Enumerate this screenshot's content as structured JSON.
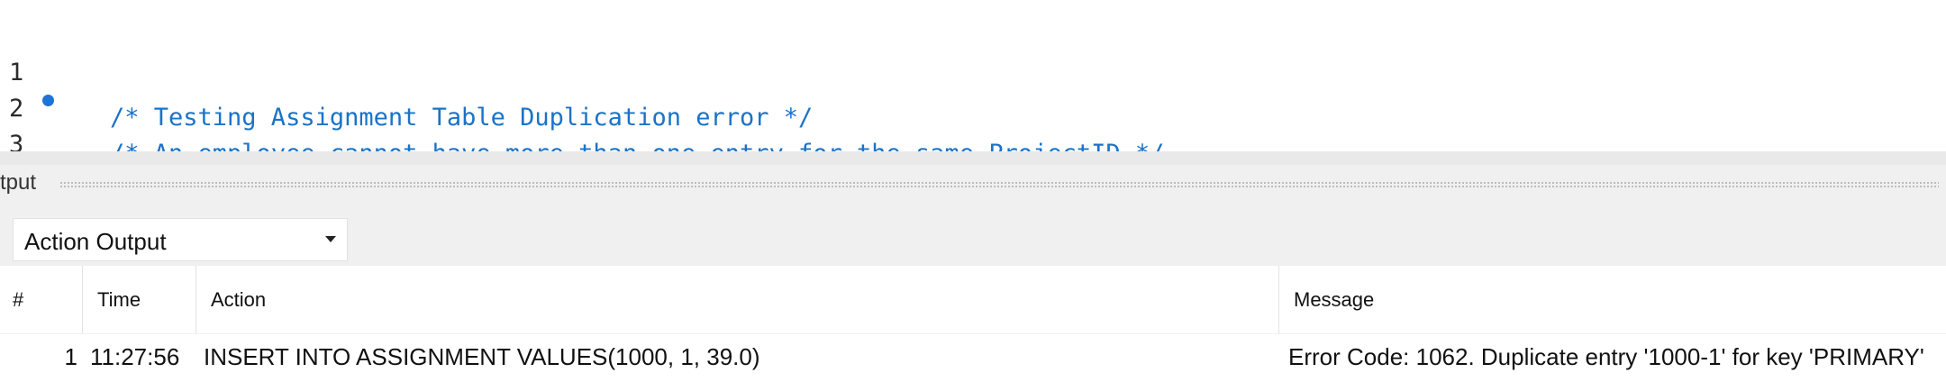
{
  "editor": {
    "lines": [
      {
        "number": "1",
        "tokens": [
          {
            "t": "/* Testing Assignment Table Duplication error */",
            "k": "comment"
          }
        ]
      },
      {
        "number": "2",
        "tokens": [
          {
            "t": "/* An employee cannot have more than one entry for the same ProjectID */",
            "k": "comment"
          }
        ]
      },
      {
        "number": "3",
        "breakpoint": true,
        "tokens": [
          {
            "t": "INSERT INTO",
            "k": "kw"
          },
          {
            "t": " ASSIGNMENT ",
            "k": "id"
          },
          {
            "t": "VALUES",
            "k": "kw"
          },
          {
            "t": "(",
            "k": "punc"
          },
          {
            "t": "1000",
            "k": "num"
          },
          {
            "t": ", ",
            "k": "punc"
          },
          {
            "t": "1",
            "k": "num"
          },
          {
            "t": ", ",
            "k": "punc"
          },
          {
            "t": "39.0",
            "k": "num"
          },
          {
            "t": ");",
            "k": "punc"
          }
        ]
      }
    ]
  },
  "output": {
    "title": "tput",
    "select_value": "Action Output",
    "columns": [
      "#",
      "Time",
      "Action",
      "Message"
    ],
    "rows": [
      {
        "num": "1",
        "time": "11:27:56",
        "action": "INSERT INTO ASSIGNMENT VALUES(1000, 1, 39.0)",
        "message": "Error Code: 1062. Duplicate entry '1000-1' for key 'PRIMARY'"
      }
    ]
  },
  "colors": {
    "keyword": "#1a73c7",
    "comment": "#1a73c7",
    "number": "#d77f0a",
    "breakpoint": "#1e73d6"
  }
}
